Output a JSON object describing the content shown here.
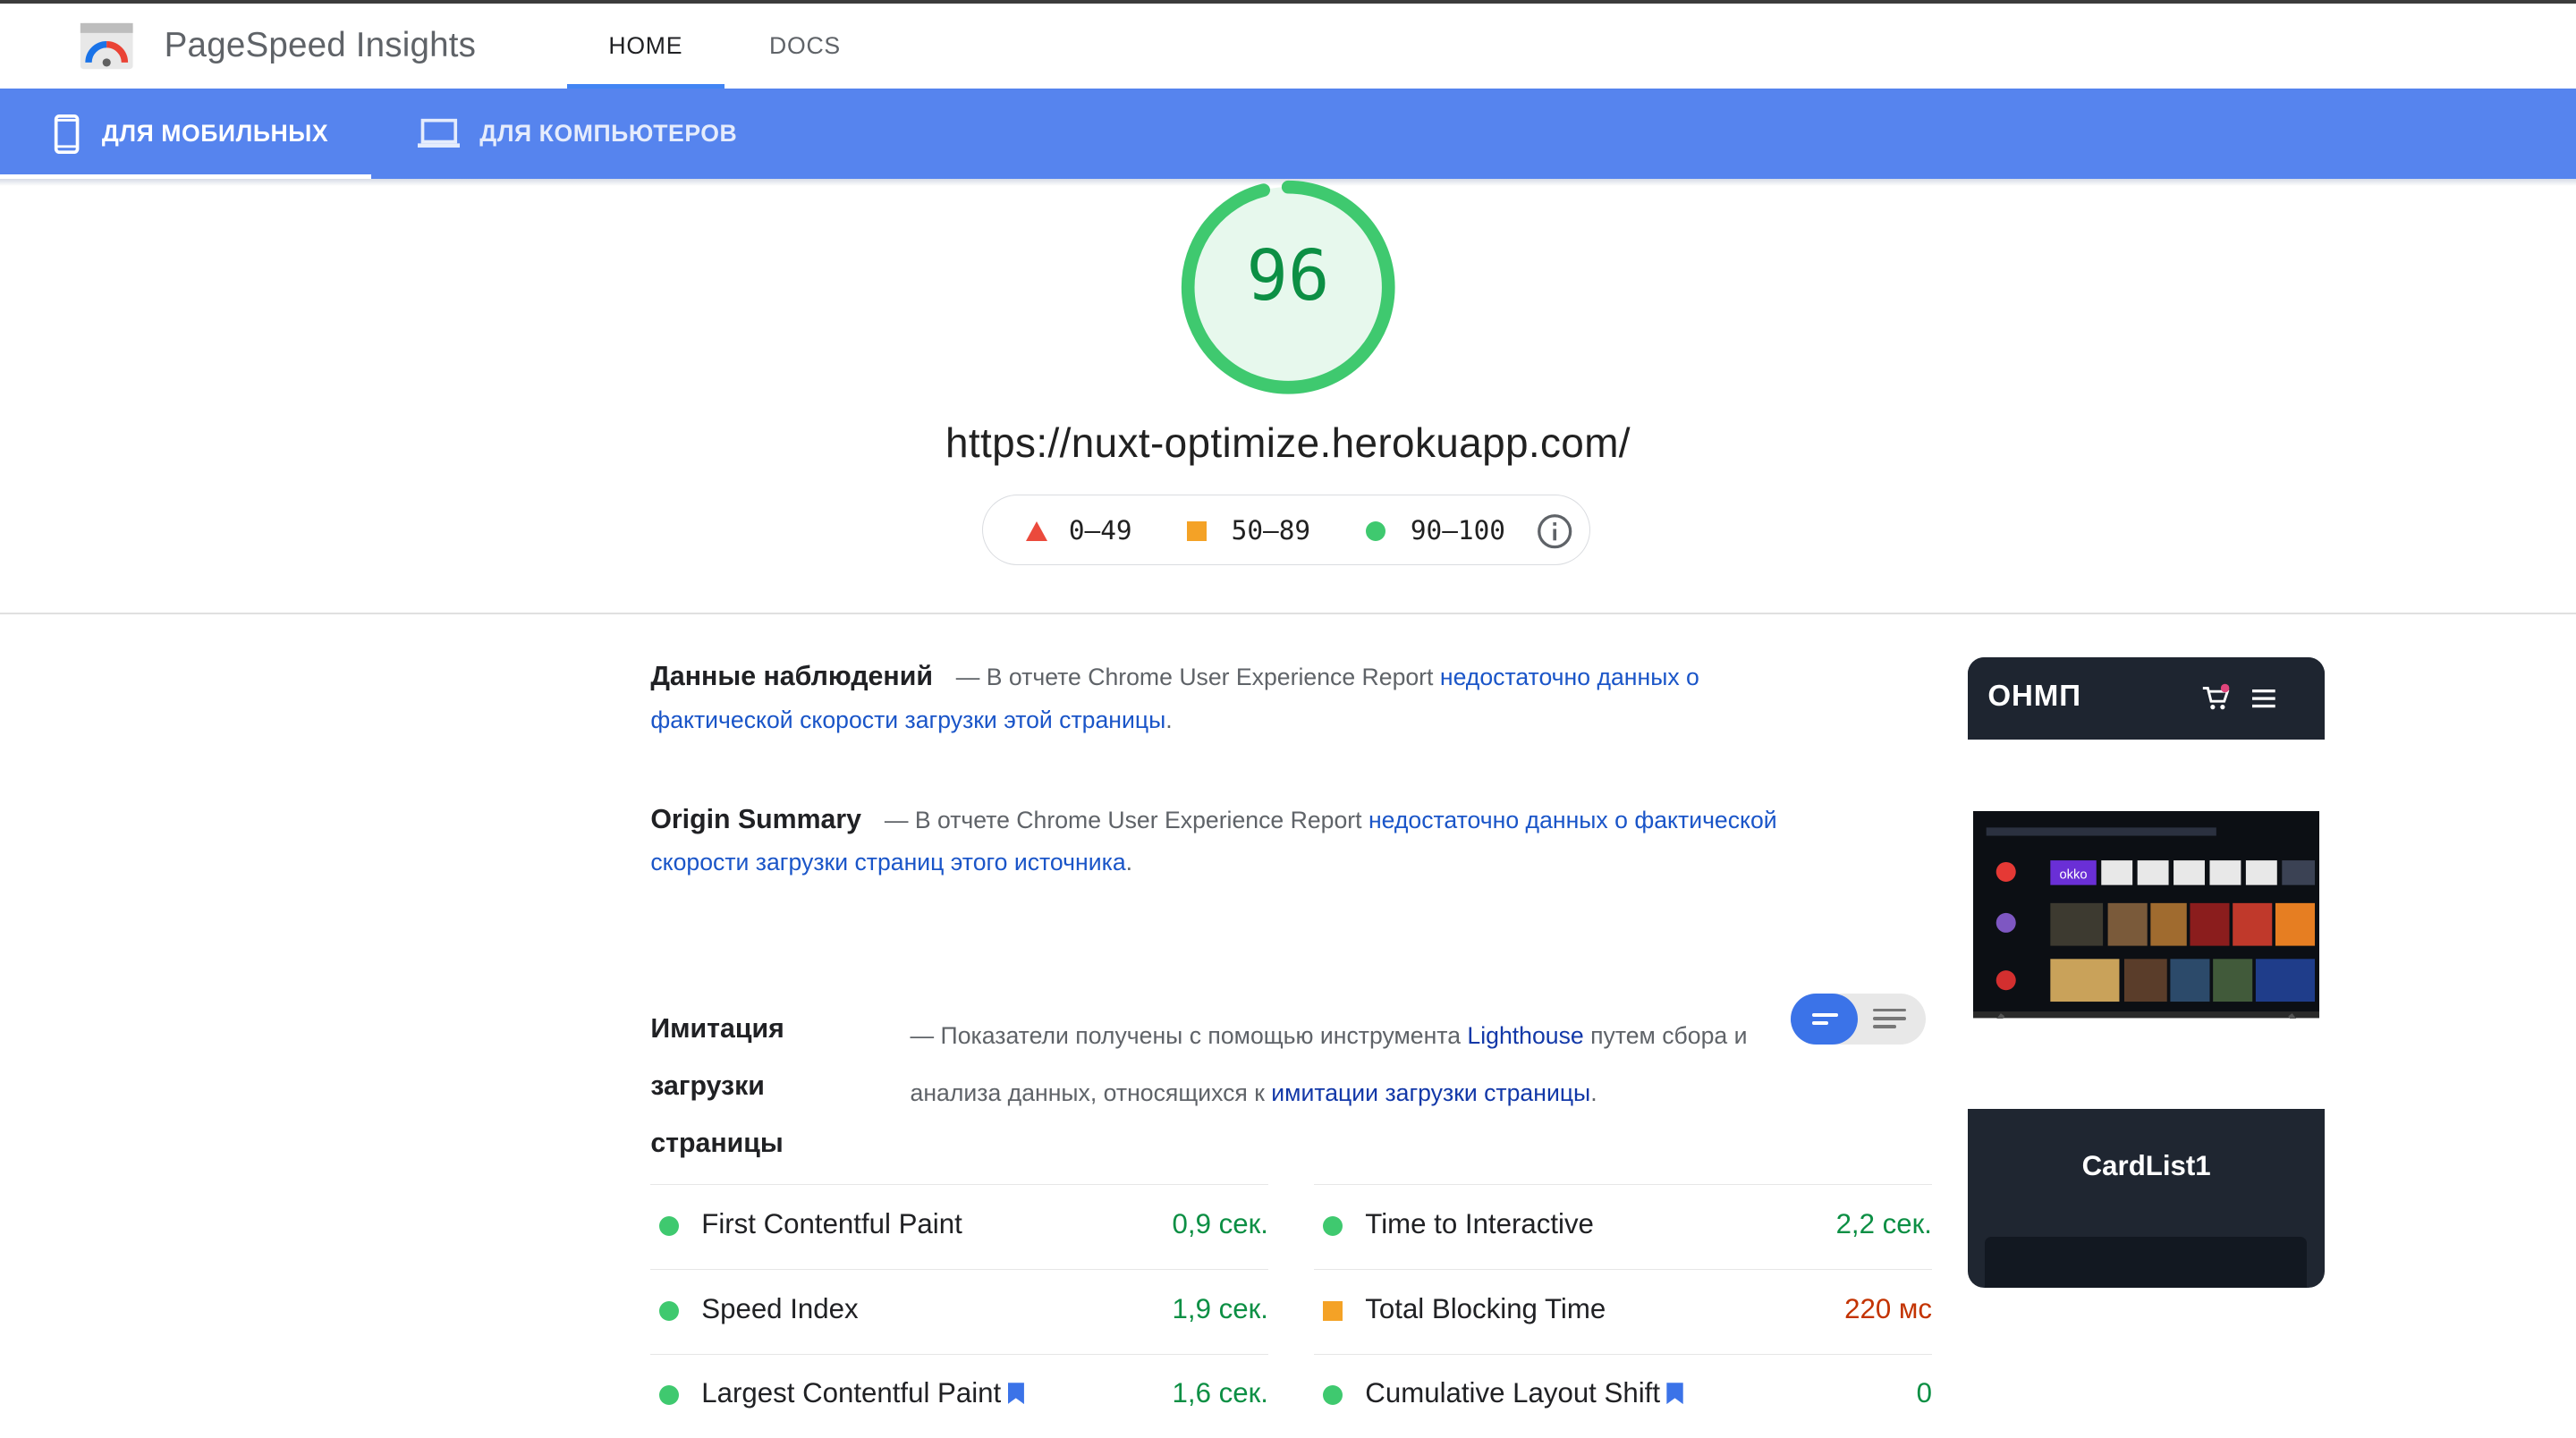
{
  "header": {
    "brand": "PageSpeed Insights",
    "logo_icon": "pagespeed-gauge-icon",
    "tabs": [
      {
        "label": "HOME",
        "active": true
      },
      {
        "label": "DOCS",
        "active": false
      }
    ]
  },
  "device_tabs": [
    {
      "label": "ДЛЯ МОБИЛЬНЫХ",
      "icon": "smartphone-icon",
      "active": true
    },
    {
      "label": "ДЛЯ КОМПЬЮТЕРОВ",
      "icon": "laptop-icon",
      "active": false
    }
  ],
  "summary": {
    "score": "96",
    "url": "https://nuxt-optimize.herokuapp.com/",
    "legend": [
      {
        "range": "0–49",
        "shape": "triangle",
        "color": "#eb4a3c"
      },
      {
        "range": "50–89",
        "shape": "square",
        "color": "#f4a226"
      },
      {
        "range": "90–100",
        "shape": "circle",
        "color": "#3fc96f"
      }
    ]
  },
  "field_data": {
    "title": "Данные наблюдений",
    "text": "— В отчете Chrome User Experience Report",
    "link": "недостаточно данных о фактической скорости загрузки этой страницы",
    "end": "."
  },
  "origin_summary": {
    "title": "Origin Summary",
    "text": "— В отчете Chrome User Experience Report",
    "link": "недостаточно данных о фактической скорости загрузки страниц этого источника",
    "end": "."
  },
  "lab_data": {
    "title": "Имитация загрузки страницы",
    "text1": "— Показатели получены с помощью инструмента",
    "link1": "Lighthouse",
    "text2": "путем сбора и анализа данных, относящихся к",
    "link2": "имитации загрузки страницы",
    "end": "."
  },
  "metrics_left": [
    {
      "name": "First Contentful Paint",
      "value": "0,9 сек.",
      "rating": "good",
      "bookmark": false
    },
    {
      "name": "Speed Index",
      "value": "1,9 сек.",
      "rating": "good",
      "bookmark": false
    },
    {
      "name": "Largest Contentful Paint",
      "value": "1,6 сек.",
      "rating": "good",
      "bookmark": true
    }
  ],
  "metrics_right": [
    {
      "name": "Time to Interactive",
      "value": "2,2 сек.",
      "rating": "good",
      "bookmark": false
    },
    {
      "name": "Total Blocking Time",
      "value": "220 мс",
      "rating": "average",
      "bookmark": false
    },
    {
      "name": "Cumulative Layout Shift",
      "value": "0",
      "rating": "good",
      "bookmark": true
    }
  ],
  "preview": {
    "site_title": "ОНМП",
    "section_title": "CardList1",
    "tv_tile_label": "okko"
  },
  "colors": {
    "accent": "#5684ee",
    "good": "#0c8f44",
    "average": "#c33300",
    "link": "#1a55c8"
  }
}
